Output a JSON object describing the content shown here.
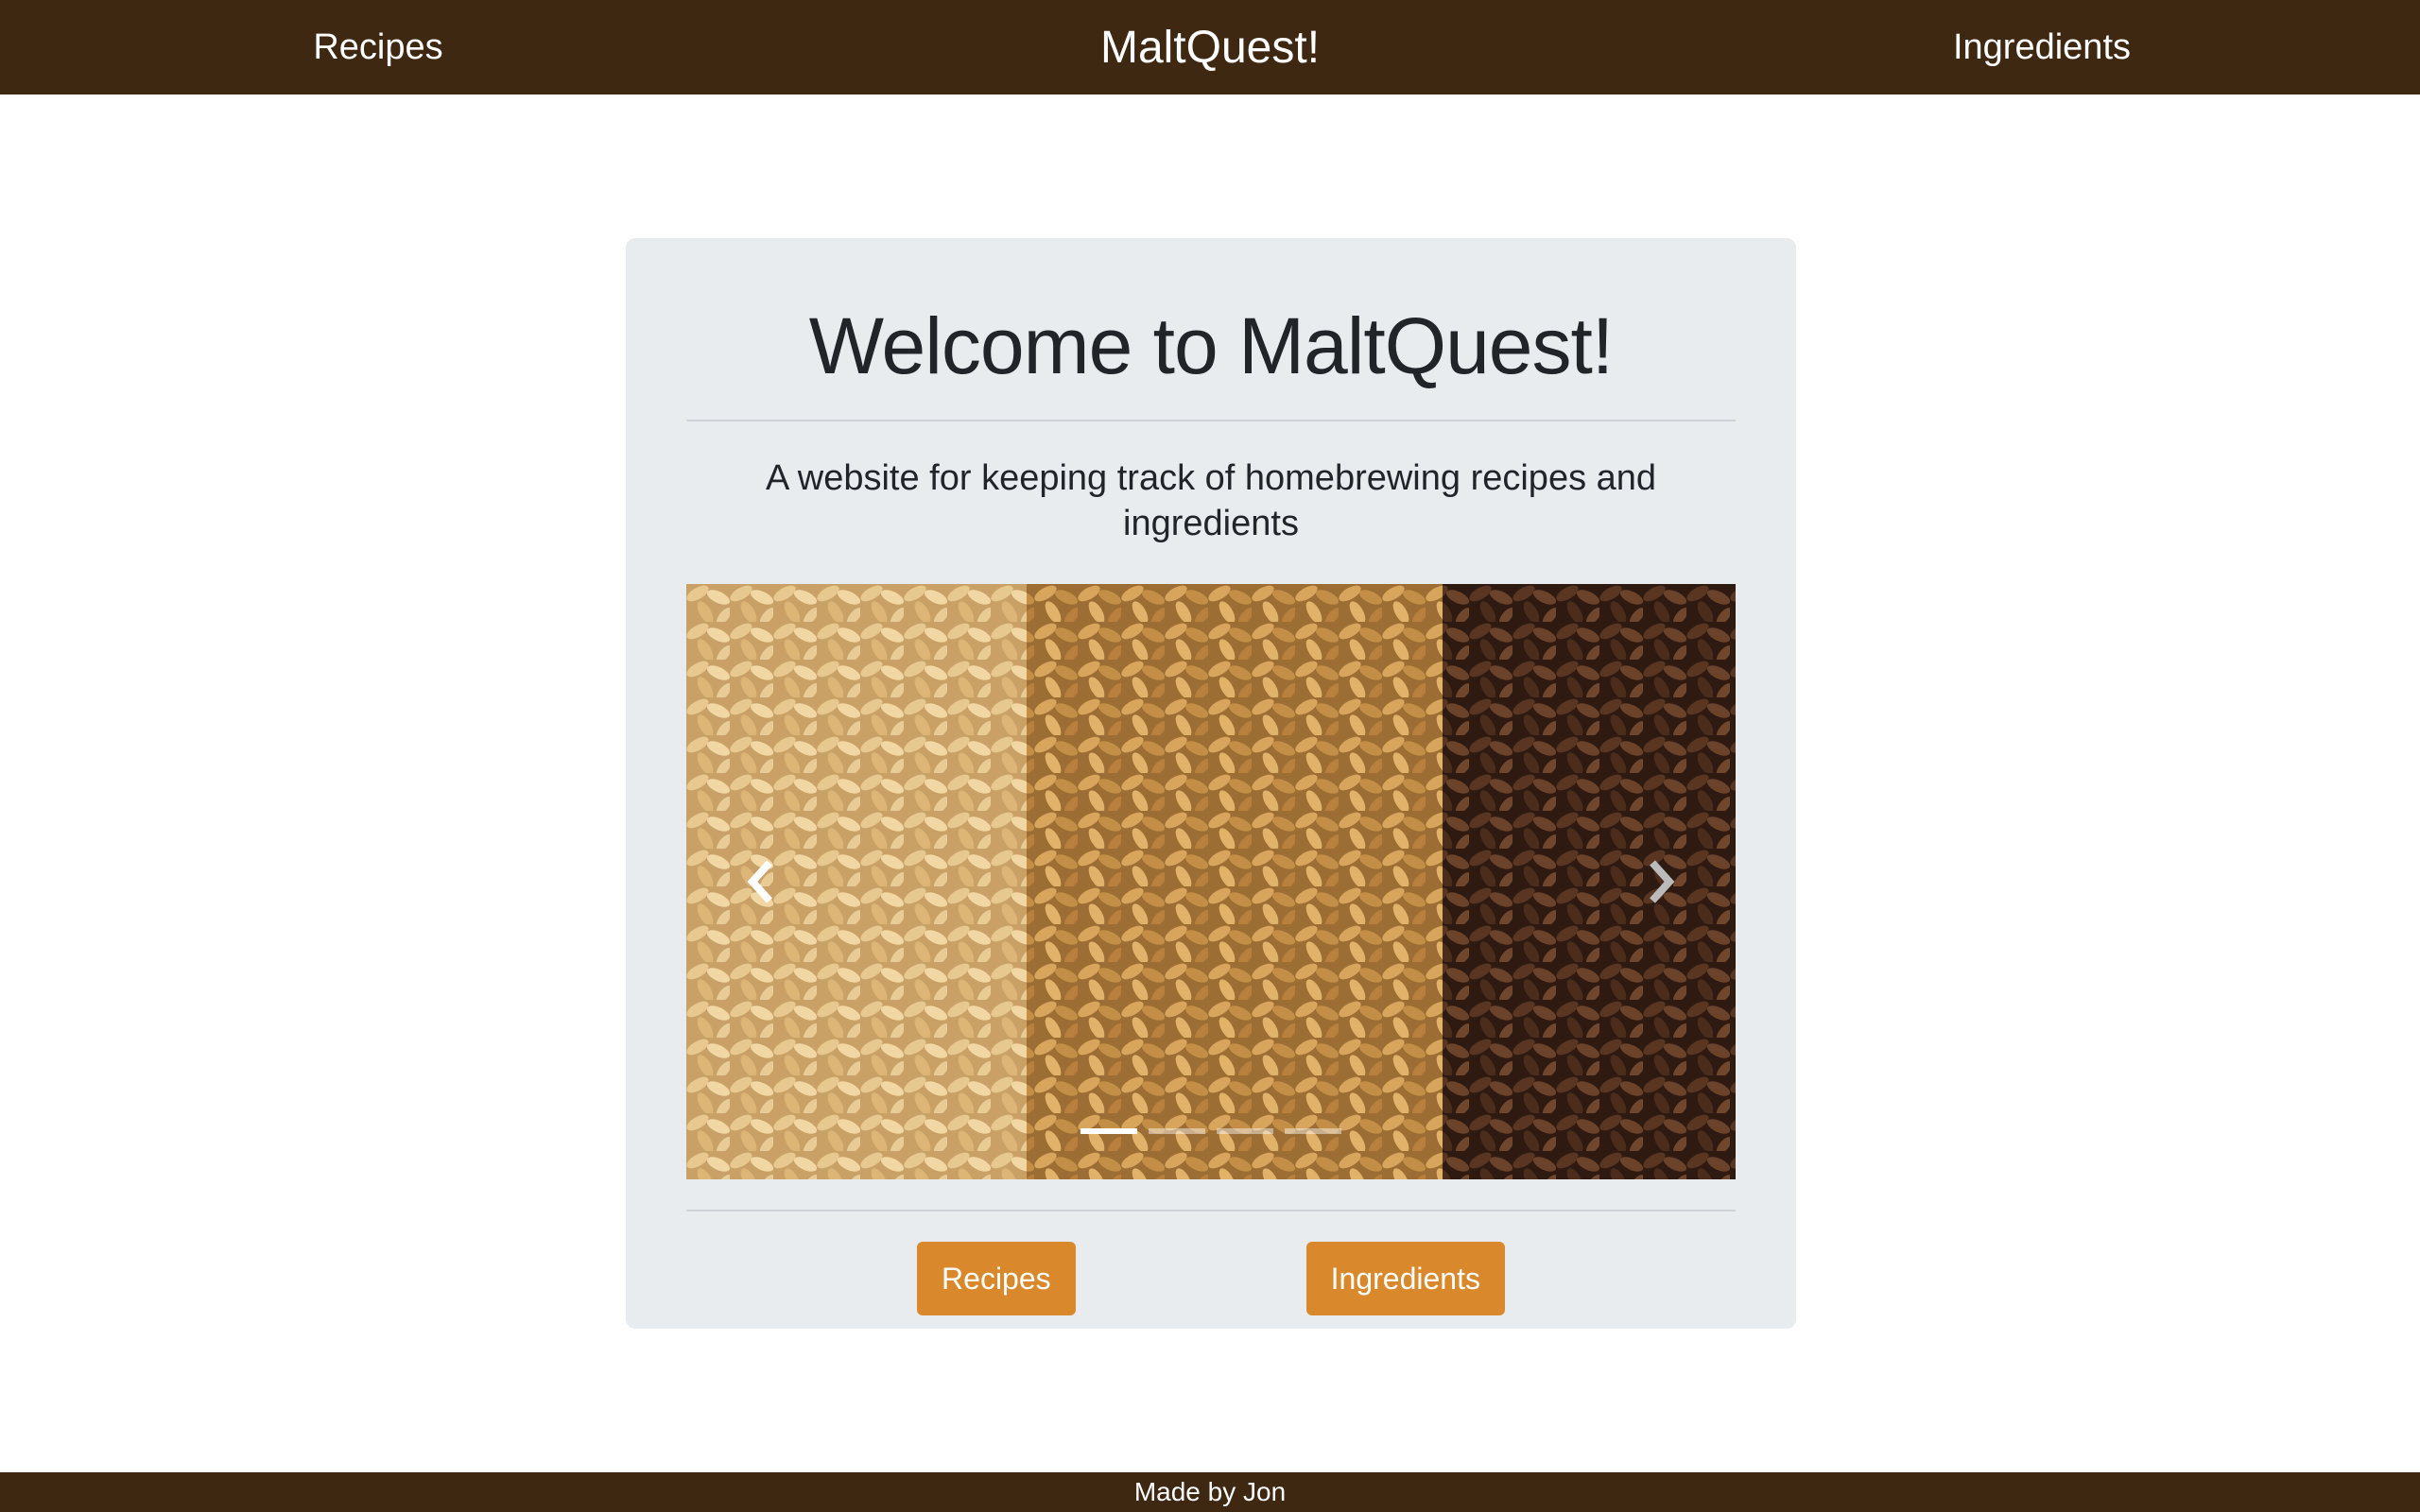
{
  "navbar": {
    "left_link": "Recipes",
    "brand": "MaltQuest!",
    "right_link": "Ingredients"
  },
  "jumbotron": {
    "headline": "Welcome to MaltQuest!",
    "lead": "A website for keeping track of homebrewing recipes and ingredients",
    "carousel": {
      "image": "malt-grains-photo",
      "prev_icon": "chevron-left-icon",
      "next_icon": "chevron-right-icon",
      "slide_count": 4,
      "active_index": 0
    },
    "buttons": {
      "recipes": "Recipes",
      "ingredients": "Ingredients"
    }
  },
  "footer": {
    "text": "Made by Jon"
  },
  "colors": {
    "navbar": "#3f2812",
    "button": "#d9892b",
    "jumbotron_bg": "#e9ecef"
  }
}
